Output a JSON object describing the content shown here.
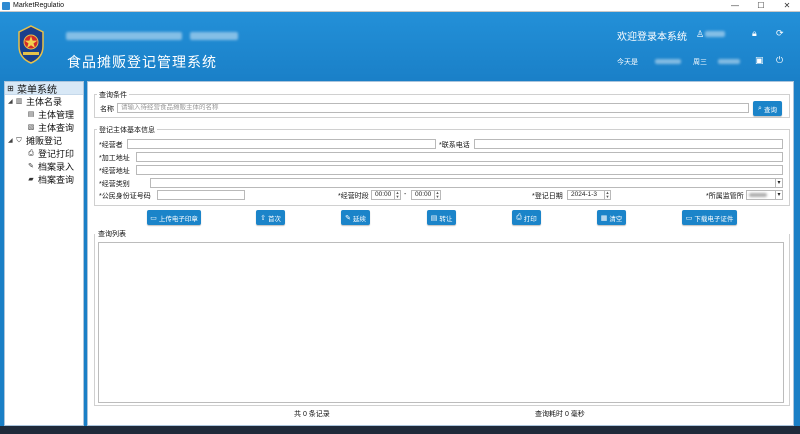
{
  "window": {
    "title": "MarketRegulatio",
    "minimize": "—",
    "maximize": "☐",
    "close": "✕"
  },
  "header": {
    "system_title": "食品摊贩登记管理系统",
    "welcome": "欢迎登录本系统",
    "today_label": "今天是",
    "weekday": "周三",
    "user_icon": "user-icon",
    "lock_icon": "lock-icon",
    "refresh_icon": "refresh-icon",
    "calendar_icon": "calendar-icon",
    "save_icon": "save-icon",
    "power_icon": "power-icon"
  },
  "sidebar": {
    "root": "菜单系统",
    "groups": [
      {
        "label": "主体名录",
        "items": [
          "主体管理",
          "主体查询"
        ]
      },
      {
        "label": "摊贩登记",
        "items": [
          "登记打印",
          "档案录入",
          "档案查询"
        ]
      }
    ]
  },
  "query": {
    "group_title": "查询条件",
    "name_label": "名称",
    "name_placeholder": "请输入待经营食品摊贩主体的名称",
    "search_button": "查询"
  },
  "info": {
    "group_title": "登记主体基本信息",
    "operator_label": "*经营者",
    "phone_label": "*联系电话",
    "processing_addr_label": "*加工地址",
    "business_addr_label": "*经营地址",
    "category_label": "*经营类别",
    "id_label": "*公民身份证号码",
    "hours_label": "*经营时段",
    "hours_start": "00:00",
    "hours_sep": "-",
    "hours_end": "00:00",
    "reg_date_label": "*登记日期",
    "reg_date": "2024-1-3",
    "station_label": "*所属监管所"
  },
  "actions": [
    {
      "label": "上传电子印章",
      "icon": "id-card-icon"
    },
    {
      "label": "首次",
      "icon": "upload-icon"
    },
    {
      "label": "延续",
      "icon": "edit-icon"
    },
    {
      "label": "转让",
      "icon": "document-icon"
    },
    {
      "label": "打印",
      "icon": "printer-icon"
    },
    {
      "label": "清空",
      "icon": "trash-icon"
    },
    {
      "label": "下载电子证件",
      "icon": "id-card-icon"
    }
  ],
  "list": {
    "group_title": "查询列表"
  },
  "footer": {
    "total": "共 0 条记录",
    "elapsed": "查询耗时 0 毫秒"
  },
  "colors": {
    "header_bg": "#2390d8",
    "button_bg": "#1b84c9",
    "page_bg": "#1a7fc6"
  }
}
